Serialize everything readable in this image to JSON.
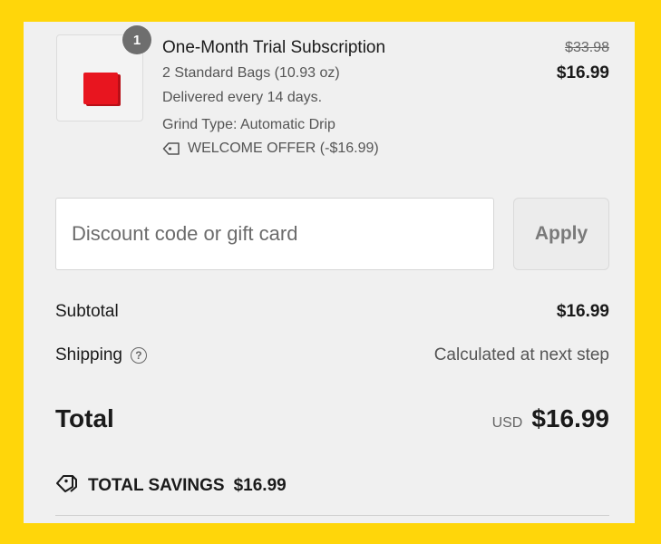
{
  "product": {
    "quantity": "1",
    "title": "One-Month Trial Subscription",
    "bags": "2 Standard Bags (10.93 oz)",
    "delivery": "Delivered every 14 days.",
    "grind": "Grind Type: Automatic Drip",
    "offer": "WELCOME OFFER (-$16.99)",
    "original_price": "$33.98",
    "price": "$16.99",
    "bag_color": "#e8151f"
  },
  "discount": {
    "placeholder": "Discount code or gift card",
    "value": "",
    "apply_label": "Apply"
  },
  "summary": {
    "subtotal_label": "Subtotal",
    "subtotal_value": "$16.99",
    "shipping_label": "Shipping",
    "shipping_value": "Calculated at next step",
    "total_label": "Total",
    "currency": "USD",
    "total_value": "$16.99",
    "savings_label": "TOTAL SAVINGS",
    "savings_value": "$16.99"
  },
  "icons": {
    "offer": "tag-icon",
    "shipping_help": "help-circle-icon",
    "savings": "tags-icon"
  },
  "colors": {
    "frame": "#ffd60a",
    "panel": "#f0f0f0"
  }
}
